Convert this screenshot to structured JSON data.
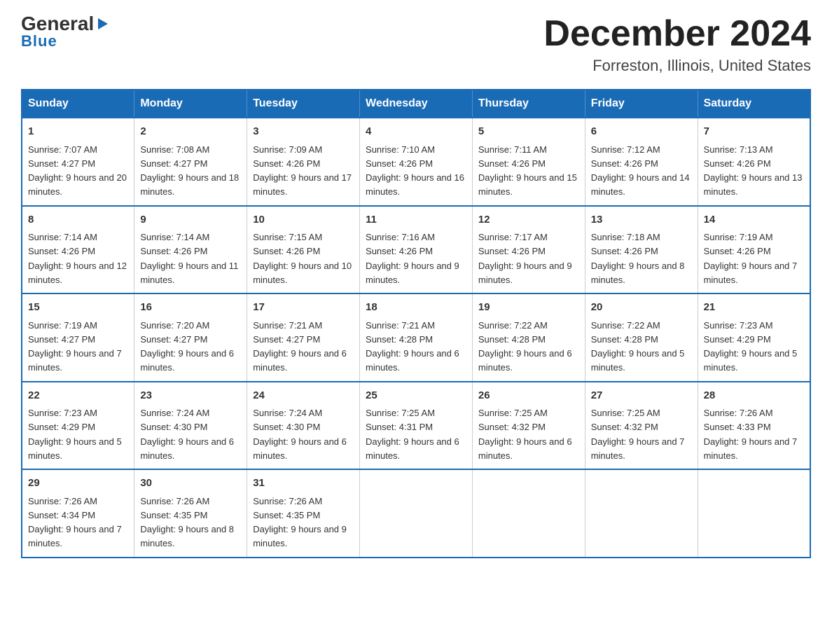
{
  "logo": {
    "general": "General",
    "arrow": "▶",
    "blue": "Blue"
  },
  "title": "December 2024",
  "subtitle": "Forreston, Illinois, United States",
  "days_of_week": [
    "Sunday",
    "Monday",
    "Tuesday",
    "Wednesday",
    "Thursday",
    "Friday",
    "Saturday"
  ],
  "weeks": [
    [
      {
        "num": "1",
        "sunrise": "7:07 AM",
        "sunset": "4:27 PM",
        "daylight": "9 hours and 20 minutes."
      },
      {
        "num": "2",
        "sunrise": "7:08 AM",
        "sunset": "4:27 PM",
        "daylight": "9 hours and 18 minutes."
      },
      {
        "num": "3",
        "sunrise": "7:09 AM",
        "sunset": "4:26 PM",
        "daylight": "9 hours and 17 minutes."
      },
      {
        "num": "4",
        "sunrise": "7:10 AM",
        "sunset": "4:26 PM",
        "daylight": "9 hours and 16 minutes."
      },
      {
        "num": "5",
        "sunrise": "7:11 AM",
        "sunset": "4:26 PM",
        "daylight": "9 hours and 15 minutes."
      },
      {
        "num": "6",
        "sunrise": "7:12 AM",
        "sunset": "4:26 PM",
        "daylight": "9 hours and 14 minutes."
      },
      {
        "num": "7",
        "sunrise": "7:13 AM",
        "sunset": "4:26 PM",
        "daylight": "9 hours and 13 minutes."
      }
    ],
    [
      {
        "num": "8",
        "sunrise": "7:14 AM",
        "sunset": "4:26 PM",
        "daylight": "9 hours and 12 minutes."
      },
      {
        "num": "9",
        "sunrise": "7:14 AM",
        "sunset": "4:26 PM",
        "daylight": "9 hours and 11 minutes."
      },
      {
        "num": "10",
        "sunrise": "7:15 AM",
        "sunset": "4:26 PM",
        "daylight": "9 hours and 10 minutes."
      },
      {
        "num": "11",
        "sunrise": "7:16 AM",
        "sunset": "4:26 PM",
        "daylight": "9 hours and 9 minutes."
      },
      {
        "num": "12",
        "sunrise": "7:17 AM",
        "sunset": "4:26 PM",
        "daylight": "9 hours and 9 minutes."
      },
      {
        "num": "13",
        "sunrise": "7:18 AM",
        "sunset": "4:26 PM",
        "daylight": "9 hours and 8 minutes."
      },
      {
        "num": "14",
        "sunrise": "7:19 AM",
        "sunset": "4:26 PM",
        "daylight": "9 hours and 7 minutes."
      }
    ],
    [
      {
        "num": "15",
        "sunrise": "7:19 AM",
        "sunset": "4:27 PM",
        "daylight": "9 hours and 7 minutes."
      },
      {
        "num": "16",
        "sunrise": "7:20 AM",
        "sunset": "4:27 PM",
        "daylight": "9 hours and 6 minutes."
      },
      {
        "num": "17",
        "sunrise": "7:21 AM",
        "sunset": "4:27 PM",
        "daylight": "9 hours and 6 minutes."
      },
      {
        "num": "18",
        "sunrise": "7:21 AM",
        "sunset": "4:28 PM",
        "daylight": "9 hours and 6 minutes."
      },
      {
        "num": "19",
        "sunrise": "7:22 AM",
        "sunset": "4:28 PM",
        "daylight": "9 hours and 6 minutes."
      },
      {
        "num": "20",
        "sunrise": "7:22 AM",
        "sunset": "4:28 PM",
        "daylight": "9 hours and 5 minutes."
      },
      {
        "num": "21",
        "sunrise": "7:23 AM",
        "sunset": "4:29 PM",
        "daylight": "9 hours and 5 minutes."
      }
    ],
    [
      {
        "num": "22",
        "sunrise": "7:23 AM",
        "sunset": "4:29 PM",
        "daylight": "9 hours and 5 minutes."
      },
      {
        "num": "23",
        "sunrise": "7:24 AM",
        "sunset": "4:30 PM",
        "daylight": "9 hours and 6 minutes."
      },
      {
        "num": "24",
        "sunrise": "7:24 AM",
        "sunset": "4:30 PM",
        "daylight": "9 hours and 6 minutes."
      },
      {
        "num": "25",
        "sunrise": "7:25 AM",
        "sunset": "4:31 PM",
        "daylight": "9 hours and 6 minutes."
      },
      {
        "num": "26",
        "sunrise": "7:25 AM",
        "sunset": "4:32 PM",
        "daylight": "9 hours and 6 minutes."
      },
      {
        "num": "27",
        "sunrise": "7:25 AM",
        "sunset": "4:32 PM",
        "daylight": "9 hours and 7 minutes."
      },
      {
        "num": "28",
        "sunrise": "7:26 AM",
        "sunset": "4:33 PM",
        "daylight": "9 hours and 7 minutes."
      }
    ],
    [
      {
        "num": "29",
        "sunrise": "7:26 AM",
        "sunset": "4:34 PM",
        "daylight": "9 hours and 7 minutes."
      },
      {
        "num": "30",
        "sunrise": "7:26 AM",
        "sunset": "4:35 PM",
        "daylight": "9 hours and 8 minutes."
      },
      {
        "num": "31",
        "sunrise": "7:26 AM",
        "sunset": "4:35 PM",
        "daylight": "9 hours and 9 minutes."
      },
      {
        "num": "",
        "sunrise": "",
        "sunset": "",
        "daylight": ""
      },
      {
        "num": "",
        "sunrise": "",
        "sunset": "",
        "daylight": ""
      },
      {
        "num": "",
        "sunrise": "",
        "sunset": "",
        "daylight": ""
      },
      {
        "num": "",
        "sunrise": "",
        "sunset": "",
        "daylight": ""
      }
    ]
  ]
}
